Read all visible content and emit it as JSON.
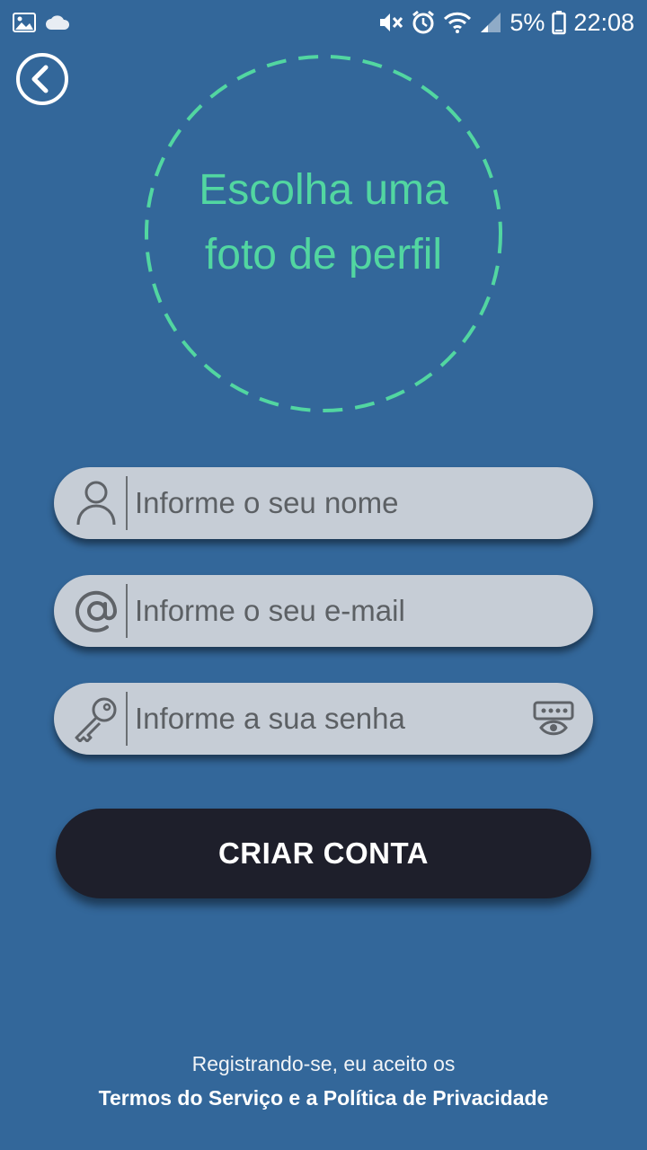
{
  "status_bar": {
    "battery": "5%",
    "time": "22:08",
    "icons": [
      "gallery-icon",
      "cloud-icon",
      "mute-icon",
      "alarm-icon",
      "wifi-icon",
      "signal-icon",
      "battery-icon"
    ]
  },
  "header": {
    "back_icon": "chevron-left-circle-icon"
  },
  "photo_picker": {
    "line1": "Escolha uma",
    "line2": "foto de perfil",
    "accent": "#52d6a1"
  },
  "form": {
    "name_placeholder": "Informe o seu nome",
    "email_placeholder": "Informe o seu e-mail",
    "password_placeholder": "Informe a sua senha",
    "name_icon": "user-icon",
    "email_icon": "at-icon",
    "password_icon": "key-icon",
    "toggle_icon": "show-password-icon"
  },
  "actions": {
    "create_account": "CRIAR CONTA"
  },
  "footer": {
    "intro": "Registrando-se, eu aceito os",
    "terms": "Termos do Serviço e a Política de Privacidade"
  },
  "colors": {
    "background": "#33679a",
    "field": "#c6cdd6",
    "button": "#1e1f2b"
  }
}
